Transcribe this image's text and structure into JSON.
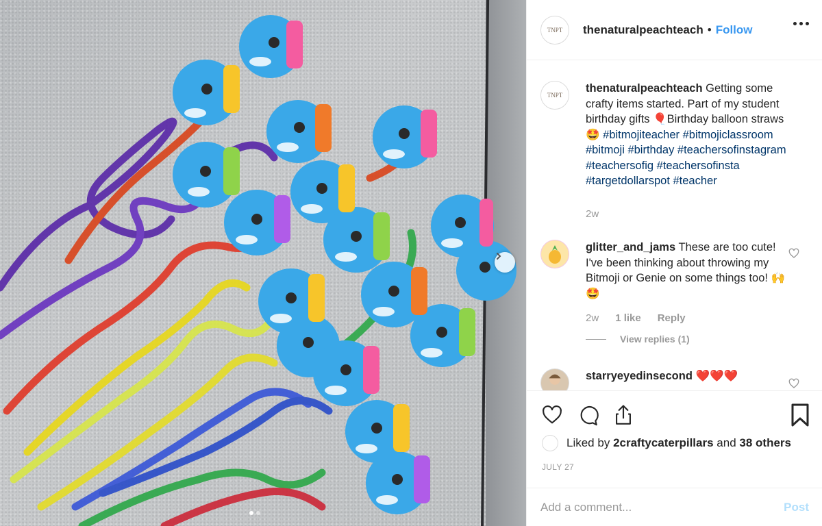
{
  "post": {
    "username": "thenaturalpeachteach",
    "separator": "•",
    "follow_label": "Follow",
    "avatar_text": "TNPT"
  },
  "caption": {
    "username": "thenaturalpeachteach",
    "text": "Getting some crafty items started. Part of my student birthday gifts 🎈Birthday balloon straws 🤩",
    "hashtags": "#bitmojiteacher #bitmojiclassroom #bitmoji #birthday #teachersofinstagram #teachersofig #teachersofinsta #targetdollarspot #teacher",
    "time": "2w"
  },
  "comments": [
    {
      "username": "glitter_and_jams",
      "text": "These are too cute! I've been thinking about throwing my Bitmoji or Genie on some things too! 🙌🤩",
      "time": "2w",
      "likes": "1 like",
      "reply_label": "Reply",
      "view_replies": "View replies (1)"
    },
    {
      "username": "starryeyedinsecond",
      "text": "❤️❤️❤️"
    }
  ],
  "likes": {
    "prefix": "Liked by",
    "user": "2craftycaterpillars",
    "suffix": "and",
    "others": "38 others"
  },
  "date": "JULY 27",
  "add_comment": {
    "placeholder": "Add a comment...",
    "post_label": "Post"
  },
  "colors": {
    "follow": "#3897f0",
    "hashtag": "#003569",
    "post_disabled": "#b2dffc"
  }
}
